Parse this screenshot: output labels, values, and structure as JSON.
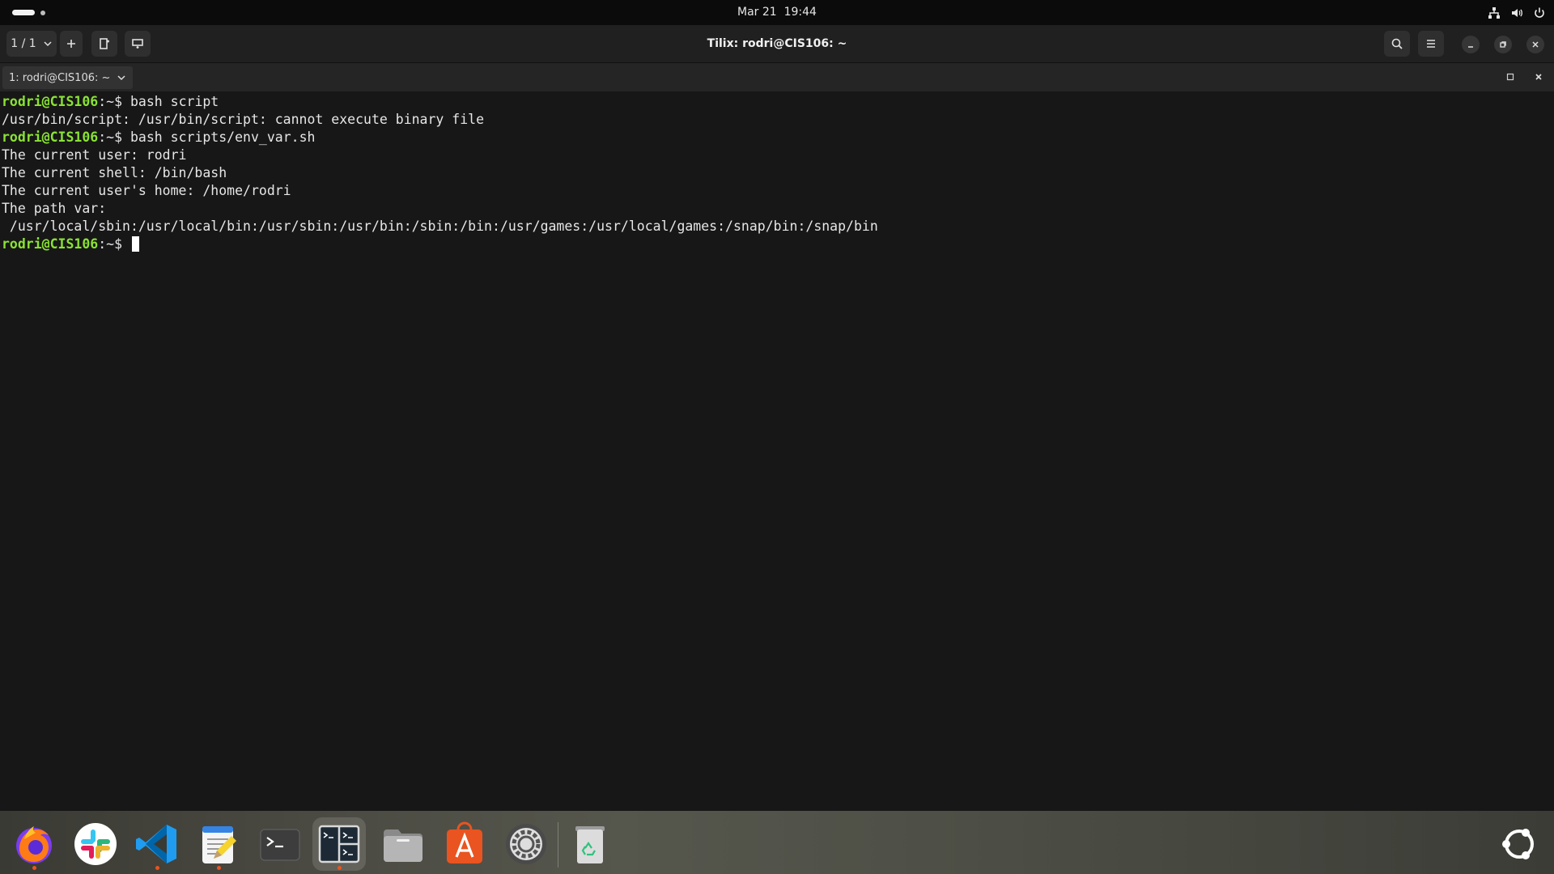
{
  "topbar": {
    "date": "Mar 21",
    "time": "19:44",
    "tray_icons": [
      "network-icon",
      "volume-icon",
      "power-icon"
    ]
  },
  "headerbar": {
    "session_label": "1 / 1",
    "window_title": "Tilix: rodri@CIS106: ~"
  },
  "terminal_tab": {
    "title": "1: rodri@CIS106: ~"
  },
  "terminal": {
    "prompt_user": "rodri@CIS106",
    "prompt_suffix": ":~$ ",
    "lines": [
      {
        "type": "prompt",
        "command": "bash script"
      },
      {
        "type": "output",
        "text": "/usr/bin/script: /usr/bin/script: cannot execute binary file"
      },
      {
        "type": "prompt",
        "command": "bash scripts/env_var.sh"
      },
      {
        "type": "output",
        "text": "The current user: rodri"
      },
      {
        "type": "output",
        "text": "The current shell: /bin/bash"
      },
      {
        "type": "output",
        "text": "The current user's home: /home/rodri"
      },
      {
        "type": "output",
        "text": "The path var:"
      },
      {
        "type": "output",
        "text": " /usr/local/sbin:/usr/local/bin:/usr/sbin:/usr/bin:/sbin:/bin:/usr/games:/usr/local/games:/snap/bin:/snap/bin"
      },
      {
        "type": "prompt",
        "command": "",
        "cursor": true
      }
    ]
  },
  "dock": {
    "apps": [
      {
        "name": "firefox-icon",
        "running": true
      },
      {
        "name": "slack-icon",
        "running": false
      },
      {
        "name": "vscode-icon",
        "running": true
      },
      {
        "name": "text-editor-icon",
        "running": true
      },
      {
        "name": "terminal-icon",
        "running": false
      },
      {
        "name": "tilix-icon",
        "running": true,
        "active": true
      },
      {
        "name": "files-icon",
        "running": false
      },
      {
        "name": "app-center-icon",
        "running": false
      },
      {
        "name": "settings-icon",
        "running": false
      },
      {
        "name": "trash-icon",
        "running": false
      }
    ],
    "show_apps_icon": "ubuntu-logo-icon"
  }
}
